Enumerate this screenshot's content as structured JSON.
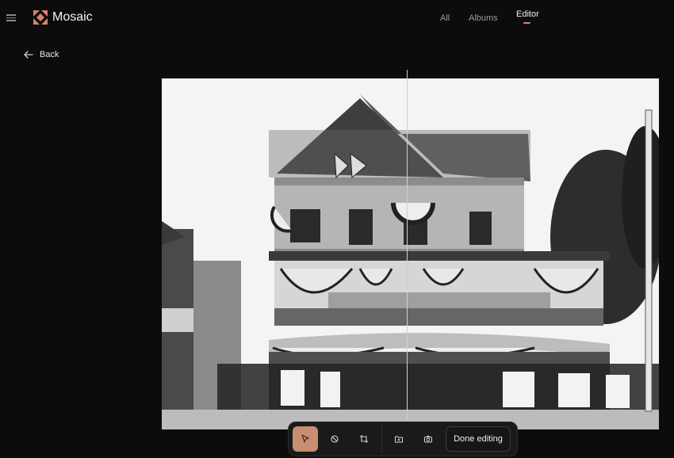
{
  "app": {
    "name": "Mosaic",
    "logo_icon": "mosaic-logo-icon",
    "accent_color": "#d9826a"
  },
  "header": {
    "menu_icon": "hamburger-icon",
    "nav": [
      {
        "label": "All",
        "active": false
      },
      {
        "label": "Albums",
        "active": false
      },
      {
        "label": "Editor",
        "active": true
      }
    ]
  },
  "back": {
    "label": "Back",
    "icon": "arrow-left-icon"
  },
  "photo": {
    "subject": "black-and-white photograph",
    "comparison_split": 0.49
  },
  "toolbar": {
    "tools": [
      {
        "icon": "cursor-icon",
        "active": true
      },
      {
        "icon": "color-palette-icon",
        "active": false
      },
      {
        "icon": "crop-icon",
        "active": false
      },
      {
        "icon": "folder-icon",
        "active": false
      },
      {
        "icon": "camera-icon",
        "active": false
      }
    ],
    "done_label": "Done editing"
  }
}
